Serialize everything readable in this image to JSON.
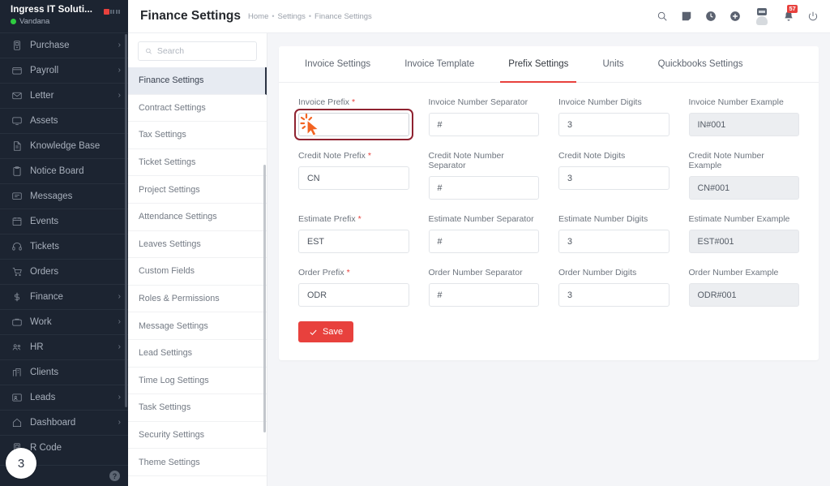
{
  "sidebar": {
    "company": "Ingress IT Soluti...",
    "username": "Vandana",
    "status_color": "#2ecc40",
    "brand_color": "#e8413d",
    "items": [
      {
        "label": "Dashboard",
        "icon": "home-icon",
        "chevron": "›"
      },
      {
        "label": "Leads",
        "icon": "leads-icon",
        "chevron": "›"
      },
      {
        "label": "Clients",
        "icon": "clients-icon",
        "chevron": ""
      },
      {
        "label": "HR",
        "icon": "people-icon",
        "chevron": "›"
      },
      {
        "label": "Work",
        "icon": "briefcase-icon",
        "chevron": "›"
      },
      {
        "label": "Finance",
        "icon": "dollar-icon",
        "chevron": "›"
      },
      {
        "label": "Orders",
        "icon": "cart-icon",
        "chevron": ""
      },
      {
        "label": "Tickets",
        "icon": "headset-icon",
        "chevron": ""
      },
      {
        "label": "Events",
        "icon": "calendar-icon",
        "chevron": ""
      },
      {
        "label": "Messages",
        "icon": "chat-icon",
        "chevron": ""
      },
      {
        "label": "Notice Board",
        "icon": "clipboard-icon",
        "chevron": ""
      },
      {
        "label": "Knowledge Base",
        "icon": "document-icon",
        "chevron": ""
      },
      {
        "label": "Assets",
        "icon": "monitor-icon",
        "chevron": ""
      },
      {
        "label": "Letter",
        "icon": "envelope-icon",
        "chevron": "›"
      },
      {
        "label": "Payroll",
        "icon": "wallet-icon",
        "chevron": "›"
      },
      {
        "label": "Purchase",
        "icon": "purchase-icon",
        "chevron": "›"
      }
    ],
    "footer_partial_label": "R Code",
    "help_icon_glyph": "?",
    "overlay_badge": "3"
  },
  "topbar": {
    "title": "Finance Settings",
    "breadcrumb": [
      "Home",
      "Settings",
      "Finance Settings"
    ],
    "separator": "•",
    "icons": [
      "search-icon",
      "note-icon",
      "clock-icon",
      "plus-circle-icon",
      "avatar",
      "bell-icon",
      "power-icon"
    ],
    "notification_count": "57",
    "badge_color": "#e8413d"
  },
  "settings_nav": {
    "search_placeholder": "Search",
    "search_value": "",
    "active": "Finance Settings",
    "items": [
      "Finance Settings",
      "Contract Settings",
      "Tax Settings",
      "Ticket Settings",
      "Project Settings",
      "Attendance Settings",
      "Leaves Settings",
      "Custom Fields",
      "Roles & Permissions",
      "Message Settings",
      "Lead Settings",
      "Time Log Settings",
      "Task Settings",
      "Security Settings",
      "Theme Settings"
    ]
  },
  "main": {
    "tabs": [
      {
        "label": "Invoice Settings",
        "active": false
      },
      {
        "label": "Invoice Template",
        "active": false
      },
      {
        "label": "Prefix Settings",
        "active": true
      },
      {
        "label": "Units",
        "active": false
      },
      {
        "label": "Quickbooks Settings",
        "active": false
      }
    ],
    "active_tab_underline_color": "#e8413d",
    "form_rows": [
      {
        "prefix": {
          "label": "Invoice Prefix",
          "required": true,
          "value": "",
          "highlighted": true,
          "readonly": false
        },
        "separator": {
          "label": "Invoice Number Separator",
          "required": false,
          "value": "#",
          "highlighted": false,
          "readonly": false
        },
        "digits": {
          "label": "Invoice Number Digits",
          "required": false,
          "value": "3",
          "highlighted": false,
          "readonly": false
        },
        "example": {
          "label": "Invoice Number Example",
          "required": false,
          "value": "IN#001",
          "highlighted": false,
          "readonly": true
        }
      },
      {
        "prefix": {
          "label": "Credit Note Prefix",
          "required": true,
          "value": "CN",
          "highlighted": false,
          "readonly": false
        },
        "separator": {
          "label": "Credit Note Number Separator",
          "required": false,
          "value": "#",
          "highlighted": false,
          "readonly": false
        },
        "digits": {
          "label": "Credit Note Digits",
          "required": false,
          "value": "3",
          "highlighted": false,
          "readonly": false
        },
        "example": {
          "label": "Credit Note Number Example",
          "required": false,
          "value": "CN#001",
          "highlighted": false,
          "readonly": true
        }
      },
      {
        "prefix": {
          "label": "Estimate Prefix",
          "required": true,
          "value": "EST",
          "highlighted": false,
          "readonly": false
        },
        "separator": {
          "label": "Estimate Number Separator",
          "required": false,
          "value": "#",
          "highlighted": false,
          "readonly": false
        },
        "digits": {
          "label": "Estimate Number Digits",
          "required": false,
          "value": "3",
          "highlighted": false,
          "readonly": false
        },
        "example": {
          "label": "Estimate Number Example",
          "required": false,
          "value": "EST#001",
          "highlighted": false,
          "readonly": true
        }
      },
      {
        "prefix": {
          "label": "Order Prefix",
          "required": true,
          "value": "ODR",
          "highlighted": false,
          "readonly": false
        },
        "separator": {
          "label": "Order Number Separator",
          "required": false,
          "value": "#",
          "highlighted": false,
          "readonly": false
        },
        "digits": {
          "label": "Order Number Digits",
          "required": false,
          "value": "3",
          "highlighted": false,
          "readonly": false
        },
        "example": {
          "label": "Order Number Example",
          "required": false,
          "value": "ODR#001",
          "highlighted": false,
          "readonly": true
        }
      }
    ],
    "save_label": "Save",
    "save_color": "#e8413d"
  }
}
